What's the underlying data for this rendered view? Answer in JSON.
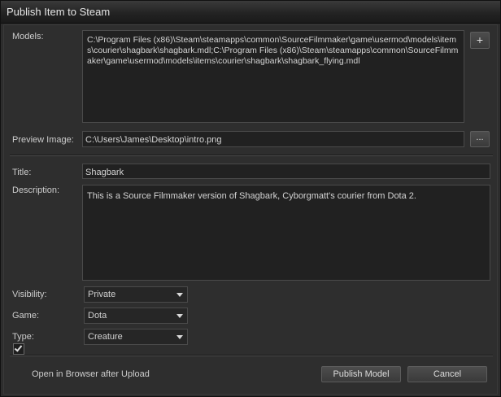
{
  "window": {
    "title": "Publish Item to Steam"
  },
  "models": {
    "label": "Models:",
    "value": "C:\\Program Files (x86)\\Steam\\steamapps\\common\\SourceFilmmaker\\game\\usermod\\models\\items\\courier\\shagbark\\shagbark.mdl;C:\\Program Files (x86)\\Steam\\steamapps\\common\\SourceFilmmaker\\game\\usermod\\models\\items\\courier\\shagbark\\shagbark_flying.mdl",
    "add_button": "+"
  },
  "preview": {
    "label": "Preview Image:",
    "value": "C:\\Users\\James\\Desktop\\intro.png",
    "browse_button": "..."
  },
  "title_field": {
    "label": "Title:",
    "value": "Shagbark"
  },
  "description": {
    "label": "Description:",
    "value": "This is a Source Filmmaker version of Shagbark, Cyborgmatt's courier from Dota 2."
  },
  "visibility": {
    "label": "Visibility:",
    "selected": "Private"
  },
  "game": {
    "label": "Game:",
    "selected": "Dota"
  },
  "type": {
    "label": "Type:",
    "selected": "Creature"
  },
  "footer": {
    "open_browser_label": "Open in Browser after Upload",
    "open_browser_checked": true,
    "publish_button": "Publish Model",
    "cancel_button": "Cancel"
  }
}
